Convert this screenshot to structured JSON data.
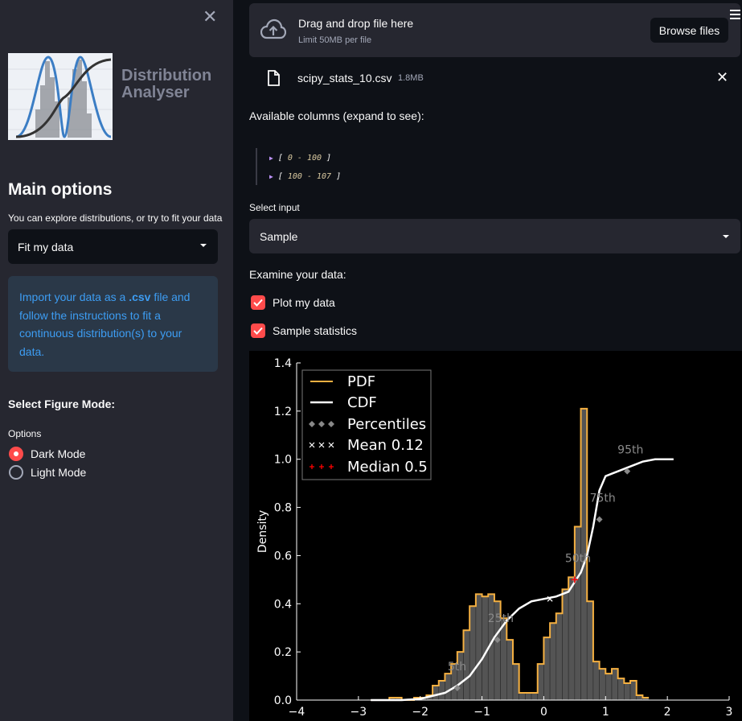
{
  "sidebar": {
    "close_icon": "close-icon",
    "brand": "Distribution Analyser",
    "brand_line1": "Distribution",
    "brand_line2": "Analyser",
    "main_options": "Main options",
    "explore_text": "You can explore distributions, or try to fit your data",
    "mode_select": "Fit my data",
    "info_part1": "Import your data as a ",
    "info_bold": ".csv",
    "info_part2": " file and follow the instructions to fit a continuous distribution(s) to your data.",
    "figure_mode_title": "Select Figure Mode:",
    "options_label": "Options",
    "radio_options": [
      {
        "label": "Dark Mode",
        "selected": true
      },
      {
        "label": "Light Mode",
        "selected": false
      }
    ]
  },
  "uploader": {
    "title": "Drag and drop file here",
    "subtitle": "Limit 50MB per file",
    "browse": "Browse files",
    "file_name": "scipy_stats_10.csv",
    "file_size": "1.8MB"
  },
  "main": {
    "available_columns": "Available columns (expand to see):",
    "json_ranges": [
      "0 - 100",
      "100 - 107"
    ],
    "select_input_label": "Select input",
    "select_input_value": "Sample",
    "examine": "Examine your data:",
    "checkboxes": [
      {
        "label": "Plot my data",
        "checked": true
      },
      {
        "label": "Sample statistics",
        "checked": true
      }
    ]
  },
  "colors": {
    "accent": "#ff4b4b",
    "sidebar_bg": "#262730",
    "app_bg": "#0e1117",
    "info_text": "#3d9df3",
    "pdf": "#f5b041",
    "cdf": "#ffffff",
    "percentile": "#888888",
    "median": "#ff0000"
  },
  "chart_data": {
    "type": "line",
    "ylabel": "Density",
    "xlim": [
      -4,
      3
    ],
    "ylim": [
      0,
      1.4
    ],
    "xticks": [
      -4,
      -3,
      -2,
      -1,
      0,
      1,
      2,
      3
    ],
    "xtick_labels": [
      "−4",
      "−3",
      "−2",
      "−1",
      "0",
      "1",
      "2",
      "3"
    ],
    "yticks": [
      0.0,
      0.2,
      0.4,
      0.6,
      0.8,
      1.0,
      1.2,
      1.4
    ],
    "ytick_labels": [
      "0.0",
      "0.2",
      "0.4",
      "0.6",
      "0.8",
      "1.0",
      "1.2",
      "1.4"
    ],
    "legend": [
      "PDF",
      "CDF",
      "Percentiles",
      "Mean 0.12",
      "Median 0.5"
    ],
    "legend_position": "top-left",
    "histogram": {
      "bin_start": -2.8,
      "bin_width": 0.1,
      "values": [
        0.0,
        0.0,
        0.0,
        0.01,
        0.01,
        0.0,
        0.0,
        0.01,
        0.01,
        0.02,
        0.06,
        0.08,
        0.11,
        0.15,
        0.2,
        0.29,
        0.39,
        0.44,
        0.43,
        0.44,
        0.41,
        0.34,
        0.25,
        0.15,
        0.03,
        0.03,
        0.03,
        0.15,
        0.26,
        0.32,
        0.36,
        0.46,
        0.51,
        0.72,
        1.21,
        0.41,
        0.16,
        0.13,
        0.11,
        0.13,
        0.09,
        0.07,
        0.08,
        0.02,
        0.01
      ]
    },
    "cdf": {
      "x": [
        -2.8,
        -2.3,
        -2.0,
        -1.6,
        -1.4,
        -1.2,
        -1.0,
        -0.8,
        -0.6,
        -0.4,
        -0.2,
        0.0,
        0.2,
        0.4,
        0.5,
        0.6,
        0.7,
        0.8,
        0.9,
        1.0,
        1.2,
        1.4,
        1.6,
        1.8,
        2.1
      ],
      "y": [
        0.0,
        0.0,
        0.005,
        0.03,
        0.06,
        0.1,
        0.17,
        0.26,
        0.33,
        0.38,
        0.41,
        0.42,
        0.43,
        0.45,
        0.49,
        0.53,
        0.6,
        0.72,
        0.87,
        0.93,
        0.95,
        0.97,
        0.99,
        1.0,
        1.0
      ]
    },
    "percentiles": [
      {
        "label": "5th",
        "x": -1.4,
        "y": 0.05
      },
      {
        "label": "25th",
        "x": -0.75,
        "y": 0.25
      },
      {
        "label": "50th",
        "x": 0.5,
        "y": 0.5
      },
      {
        "label": "75th",
        "x": 0.9,
        "y": 0.75
      },
      {
        "label": "95th",
        "x": 1.35,
        "y": 0.95
      }
    ],
    "mean": {
      "x": 0.1,
      "y": 0.42
    },
    "median": {
      "x": 0.5,
      "y": 0.5
    }
  }
}
